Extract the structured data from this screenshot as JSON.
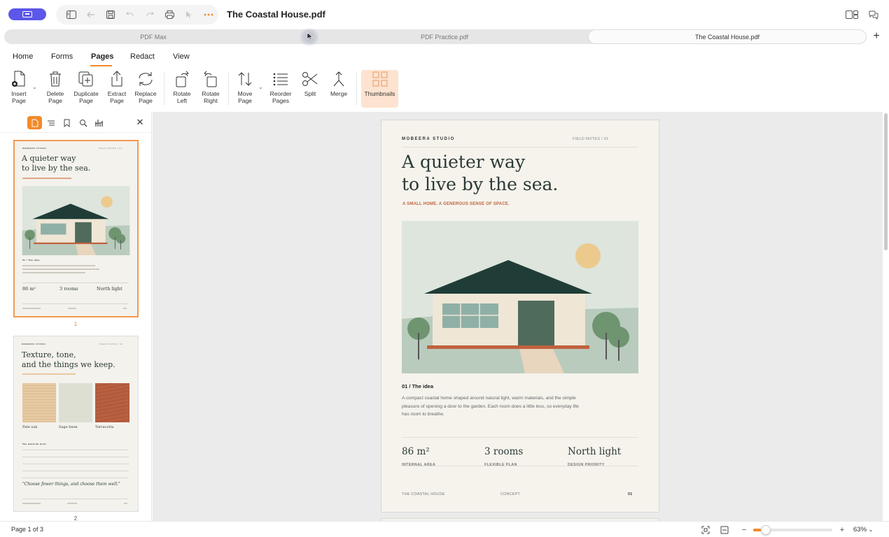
{
  "app": {
    "doc_title": "The Coastal House.pdf"
  },
  "tabs": [
    {
      "label": "PDF Max"
    },
    {
      "label": "PDF Practice.pdf"
    },
    {
      "label": "The Coastal House.pdf"
    }
  ],
  "menu": {
    "items": [
      "Home",
      "Forms",
      "Pages",
      "Redact",
      "View"
    ],
    "active": "Pages"
  },
  "ribbon": {
    "insert": "Insert\nPage",
    "delete": "Delete\nPage",
    "duplicate": "Duplicate\nPage",
    "extract": "Extract\nPage",
    "replace": "Replace\nPage",
    "rotate_left": "Rotate\nLeft",
    "rotate_right": "Rotate\nRight",
    "move": "Move\nPage",
    "reorder": "Reorder\nPages",
    "split": "Split",
    "merge": "Merge",
    "thumbnails": "Thumbnails"
  },
  "thumbnails": [
    {
      "number": "1",
      "header_left": "MOBEERA STUDIO",
      "header_right": "FIELD NOTES / 01",
      "title_line1": "A quieter way",
      "title_line2": "to live by the sea.",
      "section": "01 / The idea",
      "stats": [
        "86 m²",
        "3 rooms",
        "North light"
      ]
    },
    {
      "number": "2",
      "header_left": "MOBEERA STUDIO",
      "header_right": "FIELD NOTES / 02",
      "title_line1": "Texture, tone,",
      "title_line2": "and the things we keep.",
      "swatches": [
        "Pale oak",
        "Sage linen",
        "Terracotta"
      ],
      "section": "The material brief",
      "quote": "\"Choose fewer things, and choose them well.\""
    }
  ],
  "page": {
    "header_left": "MOBEERA STUDIO",
    "header_right": "FIELD NOTES / 01",
    "headline_line1": "A quieter way",
    "headline_line2": "to live by the sea.",
    "subtitle": "A SMALL HOME. A GENEROUS SENSE OF SPACE.",
    "section_title": "01 / The idea",
    "body": "A compact coastal home shaped around natural light, warm materials, and the simple pleasure of opening a door to the garden. Each room does a little less, so everyday life has room to breathe.",
    "stats": [
      {
        "value": "86 m²",
        "label": "INTERNAL AREA"
      },
      {
        "value": "3 rooms",
        "label": "FLEXIBLE PLAN"
      },
      {
        "value": "North light",
        "label": "DESIGN PRIORITY"
      }
    ],
    "footer_left": "THE COASTAL HOUSE",
    "footer_center": "CONCEPT",
    "footer_right": "01"
  },
  "status": {
    "page_text": "Page 1 of 3",
    "zoom": "63%",
    "zoom_level": 0.1
  },
  "colors": {
    "accent": "#f28a2a",
    "brand": "#5b57e8",
    "roof": "#1f3d36",
    "door": "#4f6b5c",
    "sun": "#ecca8e",
    "terracotta": "#c0623e"
  }
}
